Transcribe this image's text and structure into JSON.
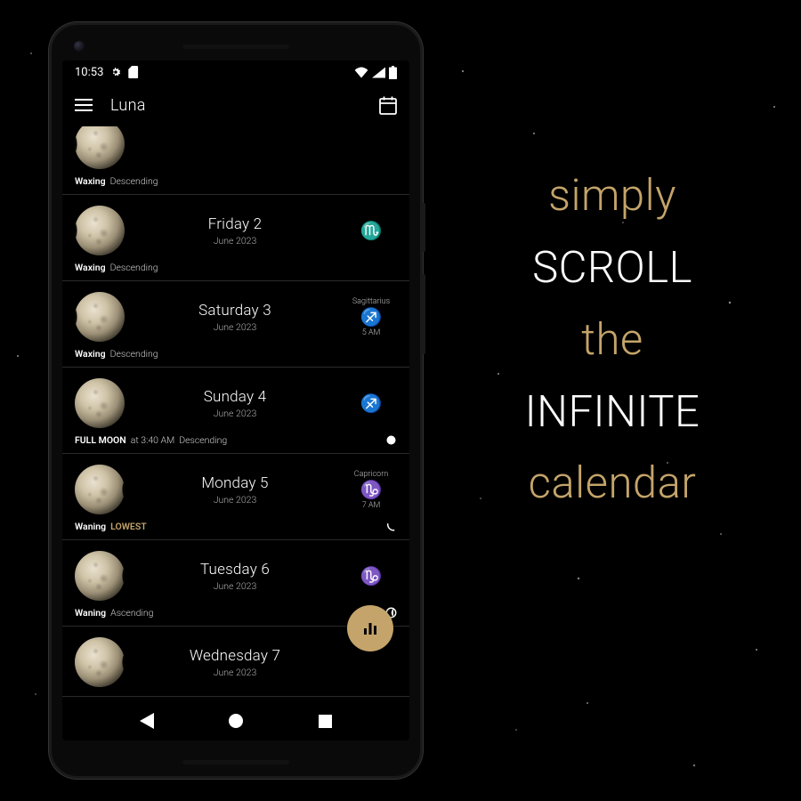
{
  "status": {
    "time": "10:53"
  },
  "app": {
    "title": "Luna"
  },
  "rows": [
    {
      "phase_class": "waxing-gibbous",
      "date": "",
      "month": "",
      "sign_name": "",
      "sign_glyph": "",
      "sign_time": "",
      "footer_bold": "Waxing",
      "footer_dim": "Descending",
      "footer_gold": "",
      "footer_time": "",
      "node": ""
    },
    {
      "phase_class": "waxing-gibbous",
      "date": "Friday 2",
      "month": "June 2023",
      "sign_name": "",
      "sign_glyph": "♏",
      "sign_time": "",
      "footer_bold": "Waxing",
      "footer_dim": "Descending",
      "footer_gold": "",
      "footer_time": "",
      "node": ""
    },
    {
      "phase_class": "waxing-gibbous",
      "date": "Saturday 3",
      "month": "June 2023",
      "sign_name": "Sagittarius",
      "sign_glyph": "♐",
      "sign_time": "5 AM",
      "footer_bold": "Waxing",
      "footer_dim": "Descending",
      "footer_gold": "",
      "footer_time": "",
      "node": ""
    },
    {
      "phase_class": "",
      "date": "Sunday 4",
      "month": "June 2023",
      "sign_name": "",
      "sign_glyph": "♐",
      "sign_time": "",
      "footer_bold": "FULL MOON",
      "footer_dim": "Descending",
      "footer_gold": "",
      "footer_time": "at 3:40 AM",
      "node": "full"
    },
    {
      "phase_class": "waning-gibbous",
      "date": "Monday 5",
      "month": "June 2023",
      "sign_name": "Capricorn",
      "sign_glyph": "♑",
      "sign_time": "7 AM",
      "footer_bold": "Waning",
      "footer_dim": "",
      "footer_gold": "LOWEST",
      "footer_time": "",
      "node": "desc"
    },
    {
      "phase_class": "waning-gibbous",
      "date": "Tuesday 6",
      "month": "June 2023",
      "sign_name": "",
      "sign_glyph": "♑",
      "sign_time": "",
      "footer_bold": "Waning",
      "footer_dim": "Ascending",
      "footer_gold": "",
      "footer_time": "",
      "node": "wan"
    },
    {
      "phase_class": "waning-gibbous",
      "date": "Wednesday 7",
      "month": "June 2023",
      "sign_name": "",
      "sign_glyph": "",
      "sign_time": "",
      "footer_bold": "",
      "footer_dim": "",
      "footer_gold": "",
      "footer_time": "",
      "node": ""
    }
  ],
  "tagline": {
    "w1": "simply",
    "w2": "SCROLL",
    "w3": "the",
    "w4": "INFINITE",
    "w5": "calendar"
  }
}
